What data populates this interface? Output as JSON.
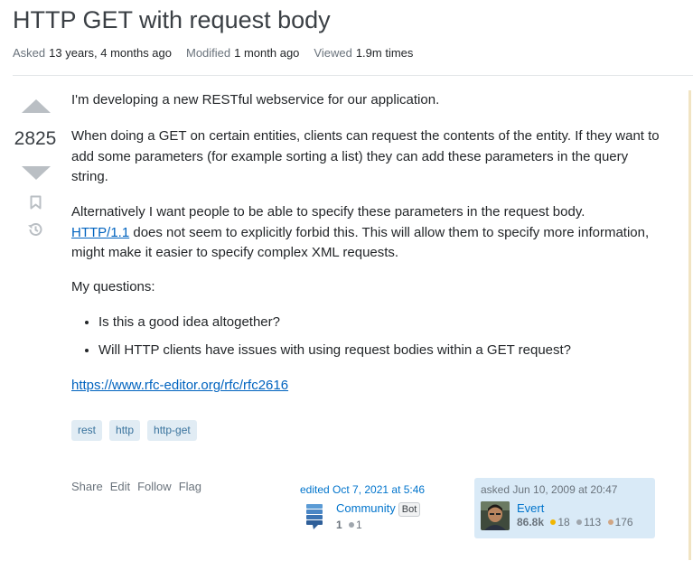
{
  "question": {
    "title": "HTTP GET with request body",
    "meta": [
      {
        "label": "Asked",
        "value": "13 years, 4 months ago"
      },
      {
        "label": "Modified",
        "value": "1 month ago"
      },
      {
        "label": "Viewed",
        "value": "1.9m times"
      }
    ],
    "score": "2825",
    "body": {
      "p1": "I'm developing a new RESTful webservice for our application.",
      "p2": "When doing a GET on certain entities, clients can request the contents of the entity. If they want to add some parameters (for example sorting a list) they can add these parameters in the query string.",
      "p3_start": "Alternatively I want people to be able to specify these parameters in the request body.",
      "p3_link": "HTTP/1.1",
      "p3_end": " does not seem to explicitly forbid this. This will allow them to specify more information, might make it easier to specify complex XML requests.",
      "p4": "My questions:",
      "bullets": [
        "Is this a good idea altogether?",
        "Will HTTP clients have issues with using request bodies within a GET request?"
      ],
      "reference_link": "https://www.rfc-editor.org/rfc/rfc2616"
    },
    "tags": [
      "rest",
      "http",
      "http-get"
    ],
    "actions": [
      "Share",
      "Edit",
      "Follow",
      "Flag"
    ],
    "edited": {
      "when": "edited Oct 7, 2021 at 5:46",
      "user": "Community",
      "bot_label": "Bot",
      "reputation": "1",
      "silver": "1"
    },
    "asked": {
      "when": "asked Jun 10, 2009 at 20:47",
      "user": "Evert",
      "reputation": "86.8k",
      "gold": "18",
      "silver": "113",
      "bronze": "176"
    }
  },
  "colors": {
    "link": "#0063bf",
    "tag_bg": "#e1ecf4",
    "tag_fg": "#39739d",
    "owner_bg": "#d9eaf7",
    "gold": "#f1b600",
    "silver": "#9fa6ad",
    "bronze": "#d1a684"
  }
}
